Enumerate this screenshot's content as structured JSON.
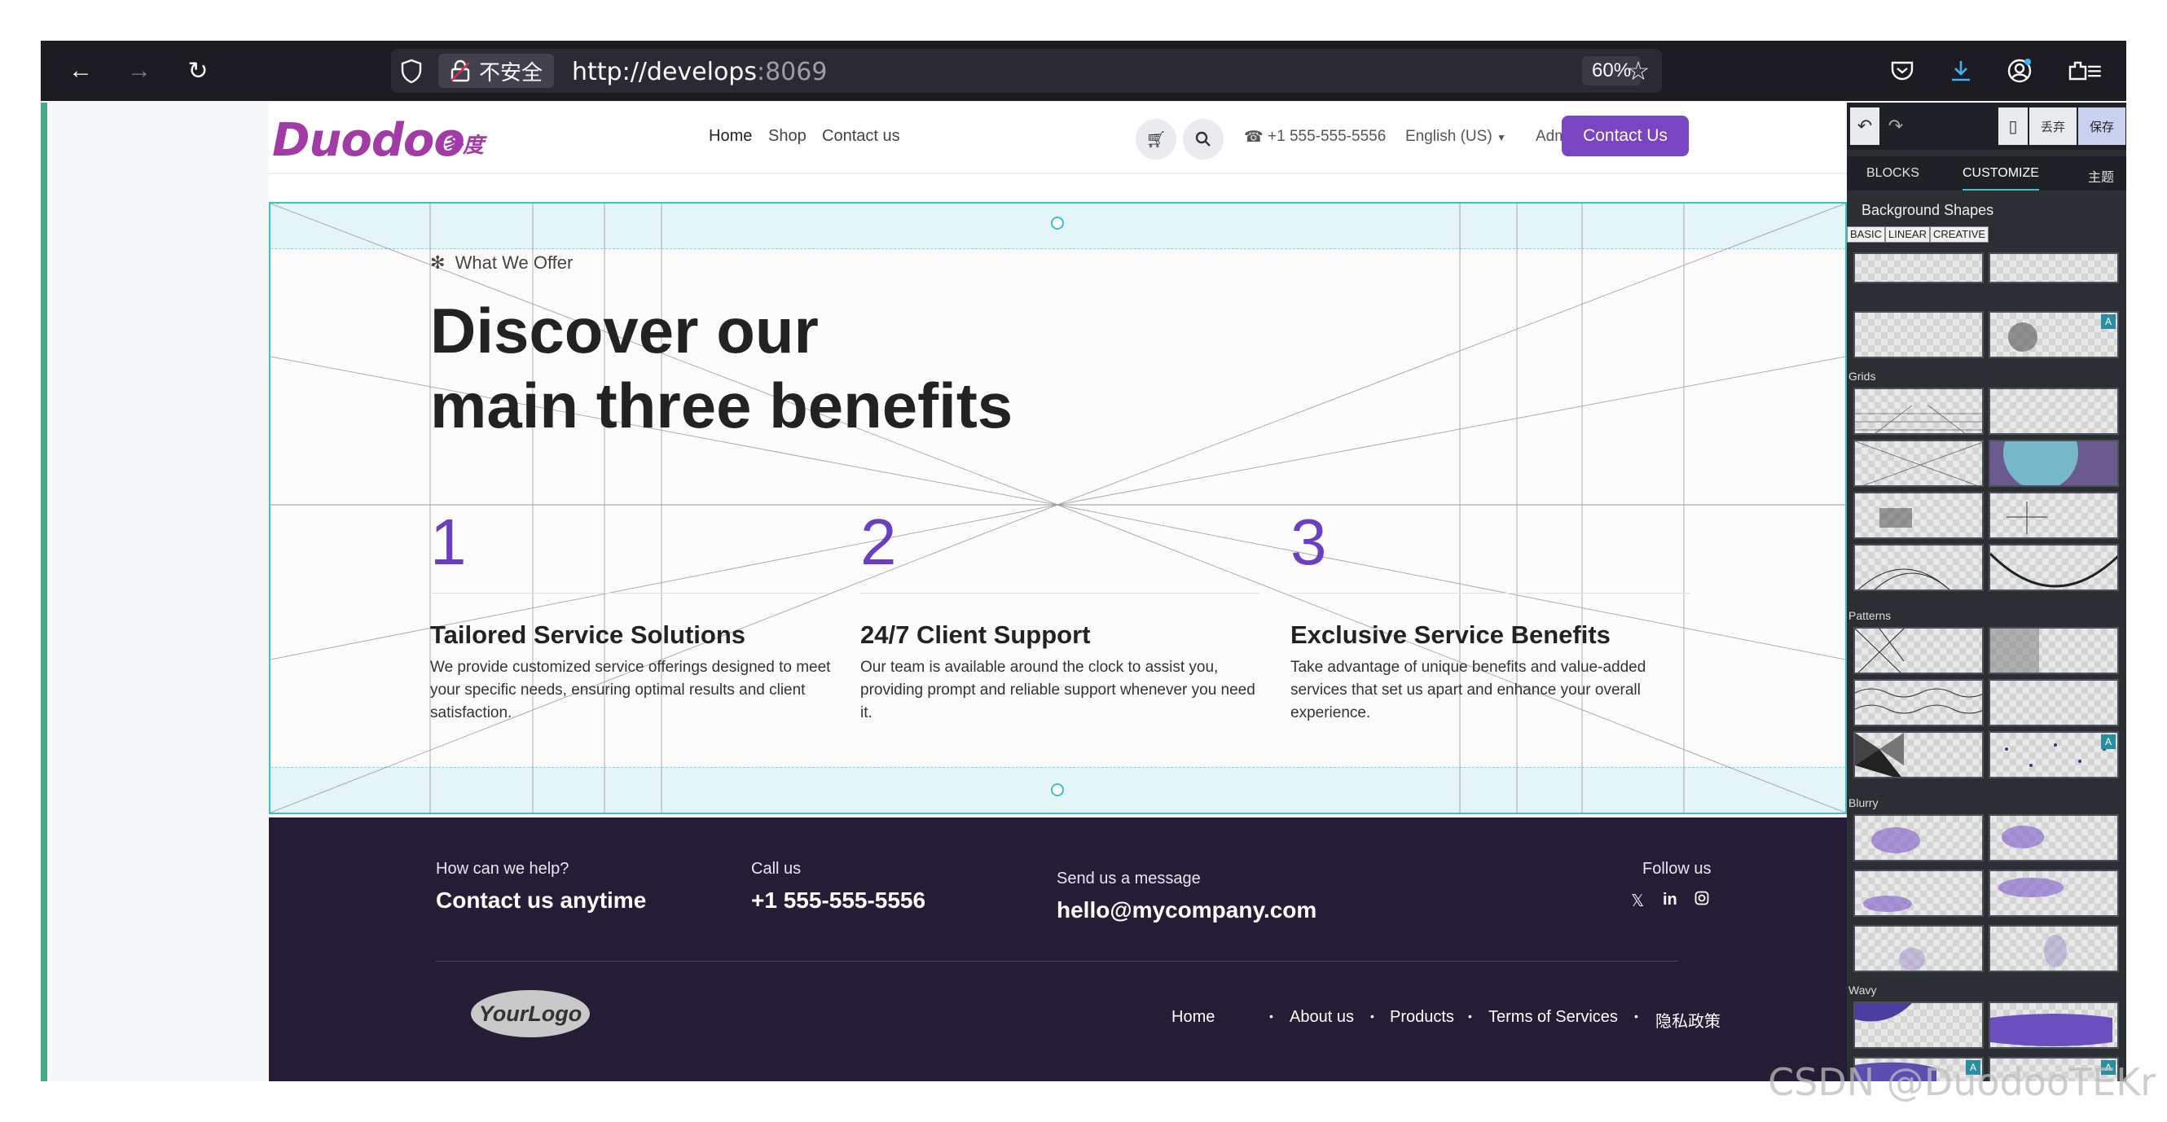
{
  "browser": {
    "security_label": "不安全",
    "url_host": "http://develops",
    "url_port": ":8069",
    "zoom": "60%"
  },
  "header": {
    "logo_text": "Duodoo",
    "logo_cn": "多度",
    "nav": [
      "Home",
      "Shop",
      "Contact us"
    ],
    "phone": "+1 555-555-5556",
    "language": "English (US)",
    "user": "Adm",
    "cta_label": "Contact Us"
  },
  "section": {
    "eyebrow": "What We Offer",
    "heading_line1": "Discover our",
    "heading_line2": "main three benefits",
    "benefits": [
      {
        "number": "1",
        "title": "Tailored Service Solutions",
        "desc": "We provide customized service offerings designed to meet your specific needs, ensuring optimal results and client satisfaction."
      },
      {
        "number": "2",
        "title": "24/7 Client Support",
        "desc": "Our team is available around the clock to assist you, providing prompt and reliable support whenever you need it."
      },
      {
        "number": "3",
        "title": "Exclusive Service Benefits",
        "desc": "Take advantage of unique benefits and value-added services that set us apart and enhance your overall experience."
      }
    ]
  },
  "footer": {
    "help_label": "How can we help?",
    "help_value": "Contact us anytime",
    "call_label": "Call us",
    "call_value": "+1 555-555-5556",
    "message_label": "Send us a message",
    "message_value": "hello@mycompany.com",
    "follow_label": "Follow us",
    "logo_text": "YourLogo",
    "links": [
      "Home",
      "About us",
      "Products",
      "Terms of Services",
      "隐私政策"
    ]
  },
  "panel": {
    "discard": "丢弃",
    "save": "保存",
    "tabs": [
      "BLOCKS",
      "CUSTOMIZE",
      "主题"
    ],
    "subtitle": "Background Shapes",
    "subtabs": [
      "BASIC",
      "LINEAR",
      "CREATIVE"
    ],
    "groups": [
      "Grids",
      "Patterns",
      "Blurry",
      "Wavy"
    ],
    "badge": "A"
  },
  "colors": {
    "brand_purple": "#7a45c2",
    "number_purple": "#6a3fc0",
    "footer_bg": "#251d36",
    "selection_teal": "#3ec0c8"
  },
  "watermark": "CSDN @DuodooTEKr"
}
